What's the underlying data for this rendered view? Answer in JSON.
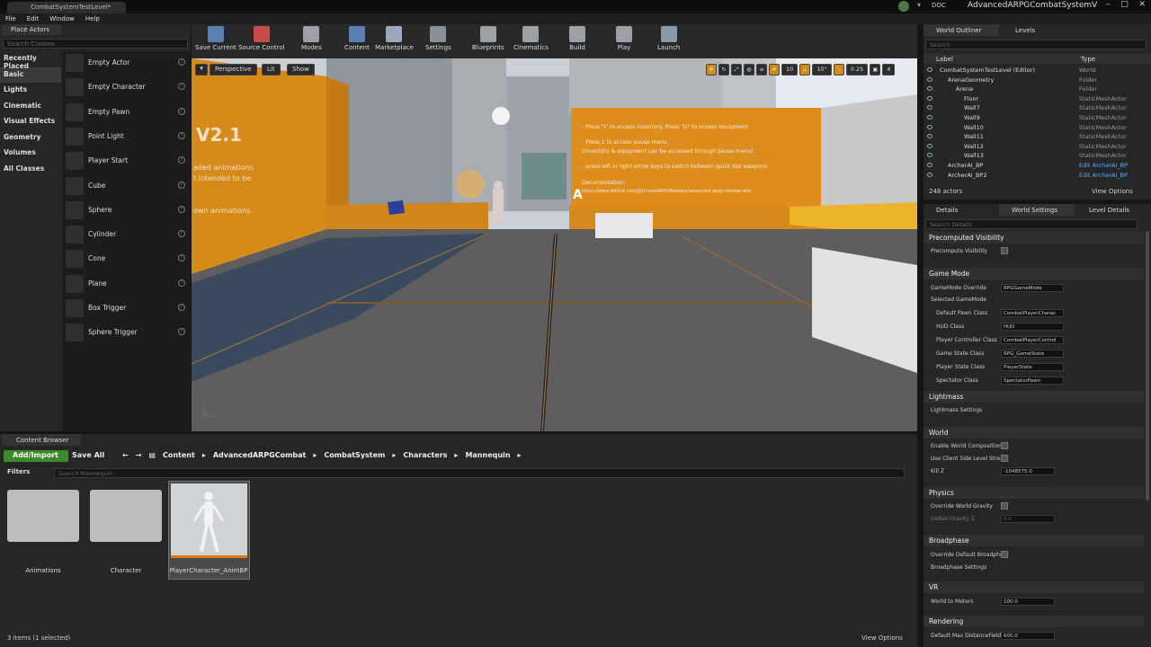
{
  "window": {
    "tab_title": "CombatSystemTestLevel*",
    "app_title": "AdvancedARPGCombatSystemV",
    "doc_label": "DOC"
  },
  "menu": [
    "File",
    "Edit",
    "Window",
    "Help"
  ],
  "place_actors": {
    "tab": "Place Actors",
    "search_placeholder": "Search Classes",
    "categories": [
      "Recently Placed",
      "Basic",
      "Lights",
      "Cinematic",
      "Visual Effects",
      "Geometry",
      "Volumes",
      "All Classes"
    ],
    "selected_category": "Basic",
    "items": [
      "Empty Actor",
      "Empty Character",
      "Empty Pawn",
      "Point Light",
      "Player Start",
      "Cube",
      "Sphere",
      "Cylinder",
      "Cone",
      "Plane",
      "Box Trigger",
      "Sphere Trigger"
    ]
  },
  "toolbar": {
    "buttons": [
      {
        "label": "Save Current",
        "icon": "save-icon"
      },
      {
        "label": "Source Control",
        "icon": "source-control-icon"
      },
      {
        "label": "Modes",
        "icon": "modes-icon"
      },
      {
        "label": "Content",
        "icon": "content-icon"
      },
      {
        "label": "Marketplace",
        "icon": "marketplace-icon"
      },
      {
        "label": "Settings",
        "icon": "settings-icon"
      },
      {
        "label": "Blueprints",
        "icon": "blueprints-icon"
      },
      {
        "label": "Cinematics",
        "icon": "cinematics-icon"
      },
      {
        "label": "Build",
        "icon": "build-icon"
      },
      {
        "label": "Play",
        "icon": "play-icon"
      },
      {
        "label": "Launch",
        "icon": "launch-icon"
      }
    ]
  },
  "viewport": {
    "perspective": "Perspective",
    "lit": "Lit",
    "show": "Show",
    "grid_snap": "10",
    "rotation_snap": "10°",
    "scale_snap": "0.25",
    "camera_speed": "4",
    "title_partial": "V2.1",
    "left_wall_lines": [
      "aded animations",
      "t intended to be",
      "own animations."
    ],
    "right_wall_lines": [
      "- Press \"I\" to access inventory. Press \"U\" to access equipment",
      "- Press 1 to access pause menu",
      "(inventory & equipment can be accessed through pause menu)",
      "- press left or right arrow keys to switch between quick slot weapons",
      "Documentation:",
      "https://www.wikifut.com/@UnrealARPGMastery/advanced-arpg-combat-wiki"
    ],
    "marker": "A"
  },
  "outliner": {
    "tabs": [
      "World Outliner",
      "Levels"
    ],
    "search_placeholder": "Search",
    "col_label": "Label",
    "col_type": "Type",
    "rows": [
      {
        "label": "CombatSystemTestLevel (Editor)",
        "type": "World",
        "indent": 0
      },
      {
        "label": "ArenaGeometry",
        "type": "Folder",
        "indent": 1
      },
      {
        "label": "Arena",
        "type": "Folder",
        "indent": 2
      },
      {
        "label": "Floor",
        "type": "StaticMeshActor",
        "indent": 3
      },
      {
        "label": "Wall7",
        "type": "StaticMeshActor",
        "indent": 3
      },
      {
        "label": "Wall9",
        "type": "StaticMeshActor",
        "indent": 3
      },
      {
        "label": "Wall10",
        "type": "StaticMeshActor",
        "indent": 3
      },
      {
        "label": "Wall11",
        "type": "StaticMeshActor",
        "indent": 3
      },
      {
        "label": "Wall12",
        "type": "StaticMeshActor",
        "indent": 3
      },
      {
        "label": "Wall13",
        "type": "StaticMeshActor",
        "indent": 3
      },
      {
        "label": "ArcherAI_BP",
        "type": "Edit ArcherAI_BP",
        "indent": 1
      },
      {
        "label": "ArcherAI_BP2",
        "type": "Edit ArcherAI_BP",
        "indent": 1
      }
    ],
    "actor_count": "248 actors",
    "view_options": "View Options"
  },
  "details": {
    "tabs": [
      "Details",
      "World Settings",
      "Level Details"
    ],
    "search_placeholder": "Search Details",
    "sections": {
      "precomputed": "Precomputed Visibility",
      "game_mode": "Game Mode",
      "lightmass": "Lightmass",
      "world": "World",
      "physics": "Physics",
      "broadphase": "Broadphase",
      "vr": "VR",
      "rendering": "Rendering"
    },
    "props": {
      "precompute_visibility": "Precompute Visibility",
      "gamemode_override": "GameMode Override",
      "gamemode_override_val": "RPGGameMode",
      "selected_gamemode": "Selected GameMode",
      "default_pawn": "Default Pawn Class",
      "default_pawn_val": "CombatPlayerCharac",
      "hud": "HUD Class",
      "hud_val": "HUD",
      "player_controller": "Player Controller Class",
      "player_controller_val": "CombatPlayerControl",
      "game_state": "Game State Class",
      "game_state_val": "RPG_GameState",
      "player_state": "Player State Class",
      "player_state_val": "PlayerState",
      "spectator": "Spectator Class",
      "spectator_val": "SpectatorPawn",
      "lightmass_settings": "Lightmass Settings",
      "enable_world_comp": "Enable World Composition",
      "use_client_side": "Use Client Side Level Strea",
      "kill_z": "Kill Z",
      "kill_z_val": "-1048575.0",
      "override_gravity": "Override World Gravity",
      "global_gravity": "Global Gravity Z",
      "global_gravity_val": "0.0",
      "override_broadphase": "Override Default Broadpha",
      "broadphase_settings": "Broadphase Settings",
      "world_to_meters": "World to Meters",
      "world_to_meters_val": "100.0",
      "default_max_df": "Default Max DistanceField",
      "default_max_df_val": "600.0"
    }
  },
  "content_browser": {
    "tab": "Content Browser",
    "add_import": "Add/Import",
    "save_all": "Save All",
    "breadcrumbs": [
      "Content",
      "AdvancedARPGCombat",
      "CombatSystem",
      "Characters",
      "Mannequin"
    ],
    "filters": "Filters",
    "search_placeholder": "Search Mannequin",
    "assets": [
      "Animations",
      "Character",
      "PlayerCharacter_AnimBP"
    ],
    "status": "3 items (1 selected)",
    "view_options": "View Options"
  }
}
